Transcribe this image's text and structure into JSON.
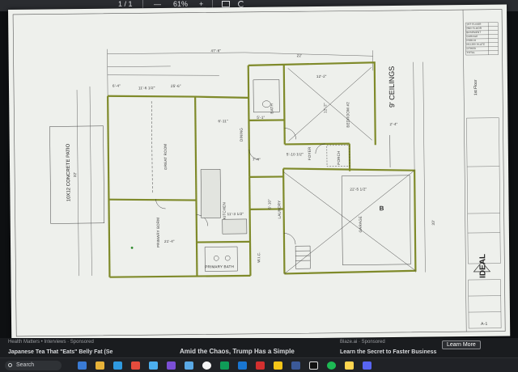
{
  "toolbar": {
    "page_indicator": "1 / 1",
    "zoom_minus": "—",
    "zoom_level": "61%",
    "zoom_plus": "+",
    "fit_icon": "fit-page-icon",
    "rotate_icon": "rotate-icon"
  },
  "plan": {
    "ceiling_note": "9' CEILINGS",
    "rooms": {
      "great_room": "GREAT ROOM",
      "patio": "10X12 CONCRETE PATIO",
      "primary_bedroom": "PRIMARY BDRM",
      "primary_bath": "PRIMARY BATH",
      "kitchen": "KITCHEN",
      "dining": "DINING",
      "bath": "BATH",
      "bedroom2": "BEDROOM #2",
      "foyer": "FOYER",
      "porch": "PORCH",
      "laundry": "LAUNDRY",
      "garage": "GARAGE",
      "garage_mark": "B",
      "wic": "W.I.C."
    },
    "dimensions": {
      "overall_top": "47'-6\"",
      "top_right": "22'",
      "left_a": "6'-4\"",
      "left_b": "11'-6 1/2\"",
      "left_c": "25'-6\"",
      "dining_w": "6'-11\"",
      "bed2_w": "12'-2\"",
      "bed2_h": "12'-2\"",
      "garage_w": "22'-5 1/2\"",
      "kitchen_w": "11'-3 1/2\"",
      "pbed_w": "21'-4\"",
      "side_left": "32'",
      "side_right": "33'",
      "foyer_a": "7'-4\"",
      "foyer_b": "5'-10 1/2\"",
      "porch_a": "2'-4\"",
      "bath_a": "5'-1\"",
      "laundry_a": "6'-10\""
    }
  },
  "title_block": {
    "company": "IDEAL",
    "subtitle": "1st Floor",
    "sheet": "A-1",
    "rev_rows": [
      "1ST FLOOR",
      "2ND FLOOR",
      "BASEMENT",
      "GARAGE",
      "PORCH",
      "FILLER PLATE",
      "OTHER",
      "TOTAL"
    ]
  },
  "news": {
    "sponsor_left": "Health Matters • Interviews · Sponsored",
    "sponsor_right": "Blaze.ai · Sponsored",
    "headline_left": "Japanese Tea That \"Eats\" Belly Fat (Se",
    "headline_center": "Amid the Chaos, Trump Has a Simple",
    "headline_right": "Learn the Secret to Faster Business",
    "learn_more": "Learn More"
  },
  "taskbar": {
    "search": "Search"
  },
  "colors": {
    "wall": "#7f8a2a",
    "line": "#2a2a2a",
    "page": "#eef0ec"
  }
}
